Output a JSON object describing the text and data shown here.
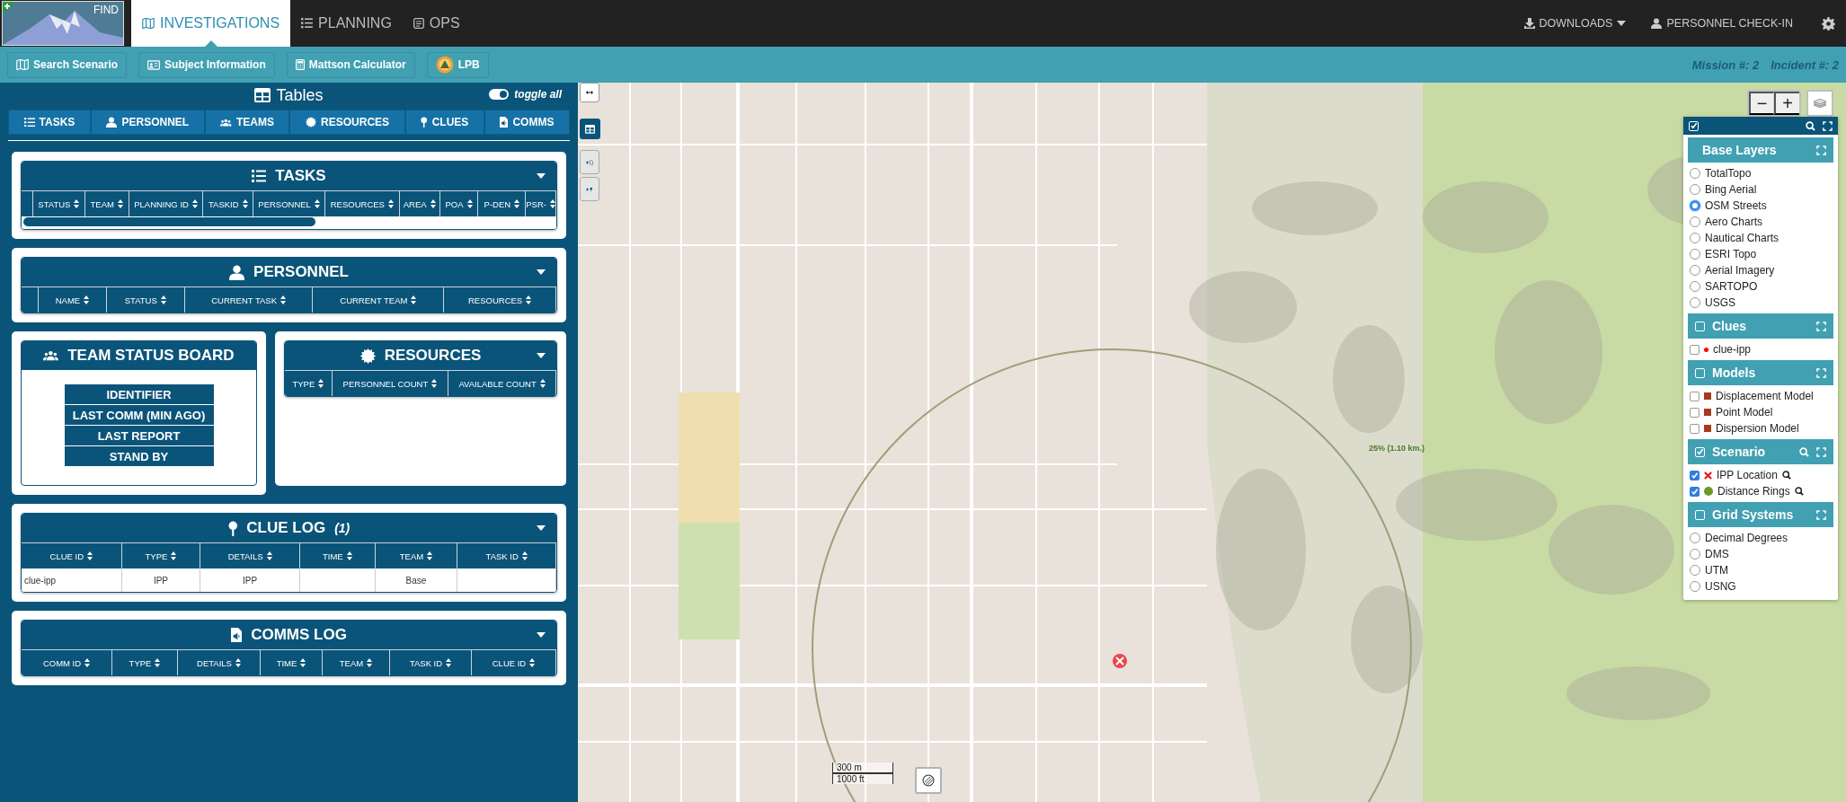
{
  "app": {
    "logo_text": "FIND"
  },
  "nav_tabs": [
    {
      "label": "INVESTIGATIONS",
      "selected": true
    },
    {
      "label": "PLANNING",
      "selected": false
    },
    {
      "label": "OPS",
      "selected": false
    }
  ],
  "top_right": [
    {
      "label": "DOWNLOADS",
      "kind": "dropdown"
    },
    {
      "label": "PERSONNEL CHECK-IN",
      "kind": "link"
    }
  ],
  "toolbar": {
    "buttons": [
      "Search Scenario",
      "Subject Information",
      "Mattson Calculator",
      "LPB"
    ],
    "mission": "Mission #: 2",
    "incident": "Incident #: 2"
  },
  "tables_panel": {
    "title": "Tables",
    "toggle": {
      "label": "toggle all",
      "on": true
    },
    "tabs": [
      "TASKS",
      "PERSONNEL",
      "TEAMS",
      "RESOURCES",
      "CLUES",
      "COMMS"
    ]
  },
  "tasks": {
    "title": "TASKS",
    "columns": [
      "STATUS",
      "TEAM",
      "PLANNING ID",
      "TASKID",
      "PERSONNEL",
      "RESOURCES",
      "AREA",
      "POA",
      "P-DEN",
      "PSR-"
    ]
  },
  "personnel": {
    "title": "PERSONNEL",
    "columns": [
      "NAME",
      "STATUS",
      "CURRENT TASK",
      "CURRENT TEAM",
      "RESOURCES"
    ]
  },
  "team_status_board": {
    "title": "TEAM STATUS BOARD",
    "rows": [
      "IDENTIFIER",
      "LAST COMM (MIN AGO)",
      "LAST REPORT",
      "STAND BY"
    ]
  },
  "resources": {
    "title": "RESOURCES",
    "columns": [
      "TYPE",
      "PERSONNEL COUNT",
      "AVAILABLE COUNT"
    ]
  },
  "clue_log": {
    "title": "CLUE LOG",
    "count": "(1)",
    "columns": [
      "CLUE ID",
      "TYPE",
      "DETAILS",
      "TIME",
      "TEAM",
      "TASK ID"
    ],
    "rows": [
      [
        "clue-ipp",
        "IPP",
        "IPP",
        "",
        "Base",
        ""
      ]
    ]
  },
  "comms_log": {
    "title": "COMMS LOG",
    "columns": [
      "COMM ID",
      "TYPE",
      "DETAILS",
      "TIME",
      "TEAM",
      "TASK ID",
      "CLUE ID"
    ]
  },
  "map": {
    "zoom_out": "−",
    "zoom_in": "+",
    "ring_label": "25% (1.10 km.)",
    "scale": [
      "300 m",
      "1000 ft"
    ]
  },
  "layers_panel": {
    "all_checked": true,
    "sections": [
      {
        "title": "Base Layers",
        "kind": "radio",
        "searchable": false,
        "items": [
          {
            "label": "TotalTopo",
            "selected": false
          },
          {
            "label": "Bing Aerial",
            "selected": false
          },
          {
            "label": "OSM Streets",
            "selected": true
          },
          {
            "label": "Aero Charts",
            "selected": false
          },
          {
            "label": "Nautical Charts",
            "selected": false
          },
          {
            "label": "ESRI Topo",
            "selected": false
          },
          {
            "label": "Aerial Imagery",
            "selected": false
          },
          {
            "label": "SARTOPO",
            "selected": false
          },
          {
            "label": "USGS",
            "selected": false
          }
        ]
      },
      {
        "title": "Clues",
        "kind": "checkbox",
        "checked": false,
        "searchable": false,
        "items": [
          {
            "label": "clue-ipp",
            "checked": false,
            "kind": "dot",
            "color": "#ff0000"
          }
        ]
      },
      {
        "title": "Models",
        "kind": "checkbox",
        "checked": false,
        "searchable": false,
        "items": [
          {
            "label": "Displacement Model",
            "checked": false,
            "kind": "square",
            "color": "#a83a1c"
          },
          {
            "label": "Point Model",
            "checked": false,
            "kind": "square",
            "color": "#a83a1c"
          },
          {
            "label": "Dispersion Model",
            "checked": false,
            "kind": "square",
            "color": "#a83a1c"
          }
        ]
      },
      {
        "title": "Scenario",
        "kind": "checkbox",
        "checked": true,
        "searchable": true,
        "items": [
          {
            "label": "IPP Location",
            "checked": true,
            "kind": "cross",
            "color": "#ee1111",
            "locate": true
          },
          {
            "label": "Distance Rings",
            "checked": true,
            "kind": "circle",
            "color": "#6a9a2a",
            "locate": true
          }
        ]
      },
      {
        "title": "Grid Systems",
        "kind": "checkbox",
        "checked": false,
        "searchable": false,
        "items": [
          {
            "label": "Decimal Degrees",
            "selected": false
          },
          {
            "label": "DMS",
            "selected": false
          },
          {
            "label": "UTM",
            "selected": false
          },
          {
            "label": "USNG",
            "selected": false
          }
        ]
      }
    ]
  }
}
